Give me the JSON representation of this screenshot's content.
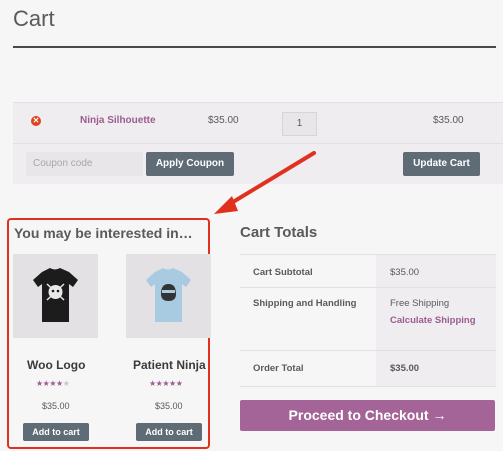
{
  "page": {
    "title": "Cart"
  },
  "cart": {
    "items": [
      {
        "name": "Ninja Silhouette",
        "price": "$35.00",
        "quantity": "1",
        "subtotal": "$35.00"
      }
    ],
    "coupon_placeholder": "Coupon code",
    "apply_coupon_label": "Apply Coupon",
    "update_cart_label": "Update Cart"
  },
  "cross_sells": {
    "title": "You may be interested in…",
    "products": [
      {
        "name": "Woo Logo",
        "rating": 4,
        "rating_max": 5,
        "price": "$35.00",
        "add_to_cart_label": "Add to cart",
        "stars": "★★★★",
        "empty_stars": "★"
      },
      {
        "name": "Patient Ninja",
        "rating": 5,
        "rating_max": 5,
        "price": "$35.00",
        "add_to_cart_label": "Add to cart",
        "stars": "★★★★★",
        "empty_stars": ""
      }
    ]
  },
  "totals": {
    "title": "Cart Totals",
    "subtotal_label": "Cart Subtotal",
    "subtotal_value": "$35.00",
    "shipping_label": "Shipping and Handling",
    "shipping_value": "Free Shipping",
    "calculate_shipping_label": "Calculate Shipping",
    "order_total_label": "Order Total",
    "order_total_value": "$35.00",
    "checkout_label": "Proceed to Checkout →"
  },
  "colors": {
    "accent": "#9b5c8f",
    "checkout": "#a46497",
    "button_gray": "#5f6b75",
    "highlight_red": "#e0301e"
  }
}
